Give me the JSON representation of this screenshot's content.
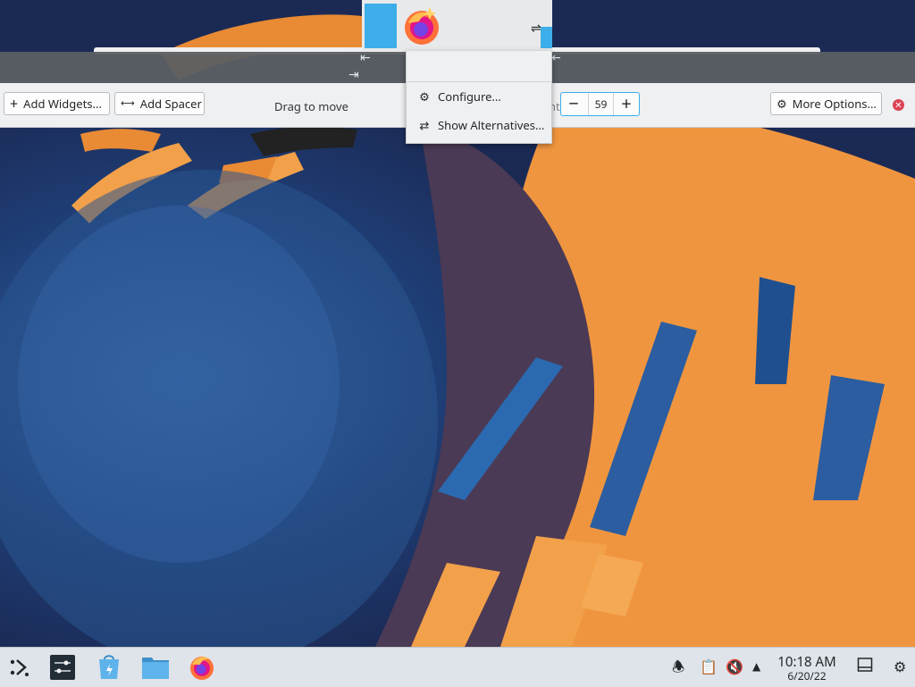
{
  "toolbar": {
    "add_widgets_label": "Add Widgets...",
    "add_spacer_label": "Add Spacer",
    "drag_label": "Drag to move",
    "height_label": "Panel height:",
    "height_value": "59",
    "more_options_label": "More Options..."
  },
  "context_menu": {
    "items": [
      {
        "label": "Configure...",
        "icon": "configure-icon"
      },
      {
        "label": "Show Alternatives...",
        "icon": "alternatives-icon"
      }
    ]
  },
  "taskbar": {
    "launchers": [
      "application-launcher-icon",
      "system-settings-icon",
      "discover-icon",
      "dolphin-icon",
      "firefox-icon"
    ],
    "tray": [
      "notifications-icon",
      "clipboard-icon",
      "volume-muted-icon",
      "show-hidden-icon"
    ],
    "clock": {
      "time": "10:18 AM",
      "date": "6/20/22"
    }
  },
  "colors": {
    "accent": "#3daee9",
    "panel_bg": "#eff0f1",
    "close": "#da4453",
    "wallpaper_orange": "#f0953f",
    "wallpaper_blue": "#2f5fa8"
  }
}
